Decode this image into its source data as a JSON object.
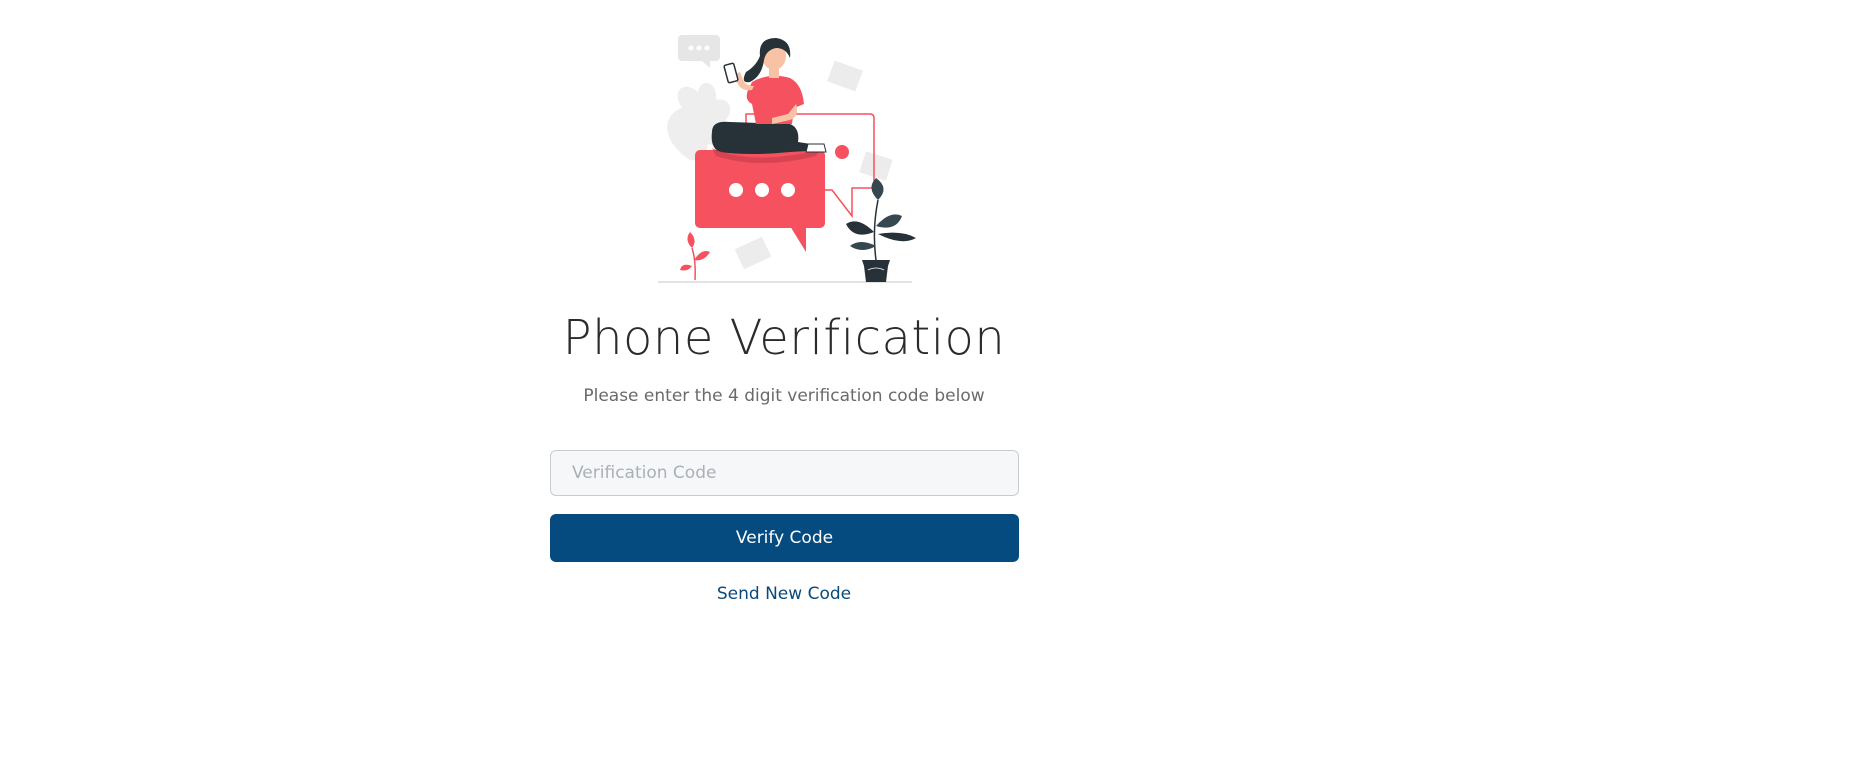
{
  "verification": {
    "title": "Phone Verification",
    "subtitle": "Please enter the 4 digit verification code below",
    "input": {
      "value": "",
      "placeholder": "Verification Code"
    },
    "verify_button_label": "Verify Code",
    "resend_link_label": "Send New Code"
  },
  "illustration": {
    "icon": "woman-with-phone-on-chat-bubbles-illustration"
  },
  "colors": {
    "accent": "#054b80",
    "illustration_red": "#f5515f",
    "illustration_dark": "#263238",
    "link": "#0a4a7a"
  }
}
